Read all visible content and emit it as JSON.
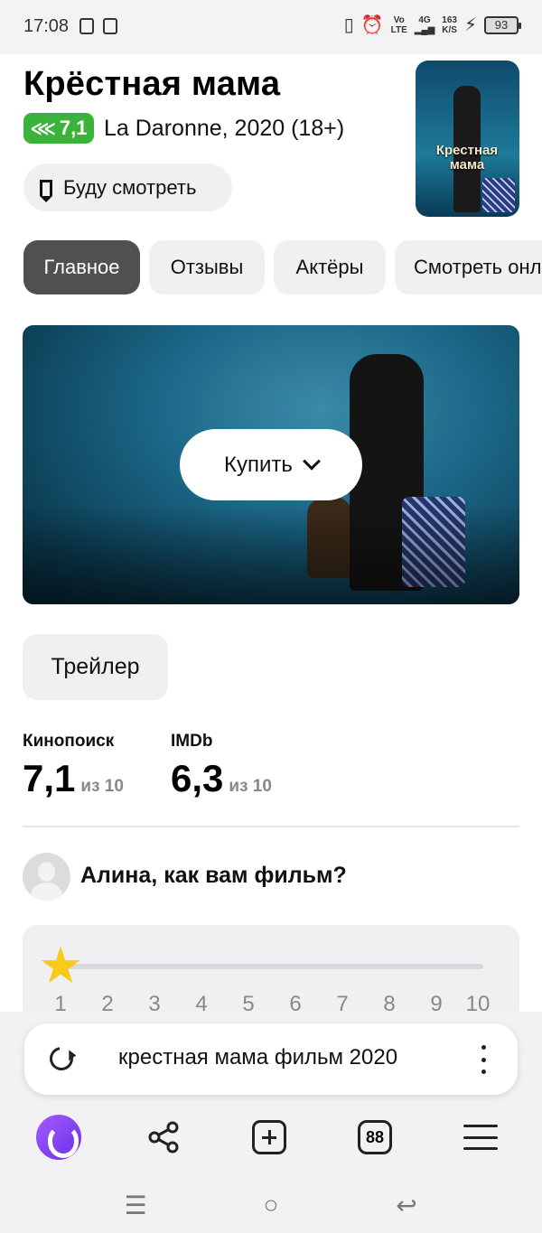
{
  "status_bar": {
    "time": "17:08",
    "net_speed_top": "163",
    "net_speed_bottom": "K/S",
    "net_type_top": "Vo",
    "net_type_bottom": "LTE",
    "signal_label": "4G",
    "battery": "93"
  },
  "movie": {
    "title": "Крёстная мама",
    "rating_badge": "7,1",
    "subtitle": "La Daronne, 2020 (18+)",
    "watch_later_label": "Буду смотреть",
    "poster_text": "Крестная мама"
  },
  "tabs": [
    {
      "label": "Главное",
      "active": true
    },
    {
      "label": "Отзывы",
      "active": false
    },
    {
      "label": "Актёры",
      "active": false
    },
    {
      "label": "Смотреть онлайн",
      "active": false
    }
  ],
  "hero": {
    "buy_label": "Купить"
  },
  "trailer_label": "Трейлер",
  "scores": [
    {
      "source": "Кинопоиск",
      "value": "7,1",
      "max": "из 10"
    },
    {
      "source": "IMDb",
      "value": "6,3",
      "max": "из 10"
    }
  ],
  "prompt": {
    "question": "Алина, как вам фильм?"
  },
  "rating_scale": {
    "selected": 1,
    "values": [
      "1",
      "2",
      "3",
      "4",
      "5",
      "6",
      "7",
      "8",
      "9",
      "10"
    ]
  },
  "browser": {
    "search_query": "крестная мама фильм 2020",
    "tab_count": "88"
  },
  "colors": {
    "badge_green": "#3bb33b",
    "star_yellow": "#fbc918",
    "active_tab": "#505050",
    "alice_purple": "#7b3cf0"
  },
  "icons": [
    "bookmark-icon",
    "reload-icon",
    "more-icon",
    "alice-icon",
    "share-icon",
    "new-tab-icon",
    "tabs-icon",
    "menu-icon",
    "star-icon"
  ]
}
